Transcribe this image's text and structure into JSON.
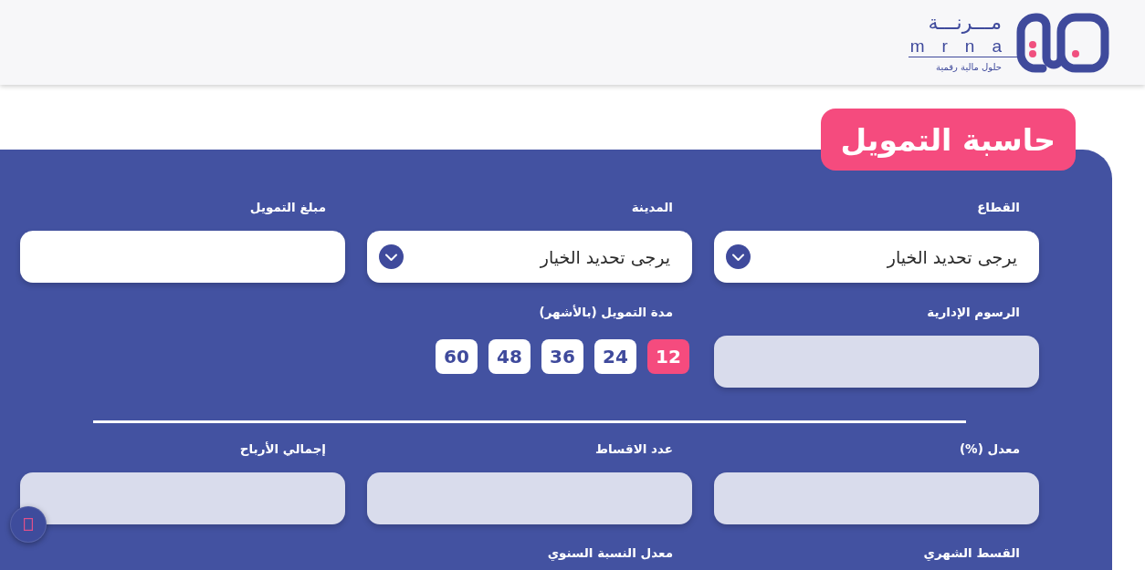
{
  "header": {
    "logo": {
      "name": "مـــرنـــة",
      "latin_name": "mrna",
      "tagline": "حلول مالية رقمية"
    }
  },
  "calculator": {
    "title": "حاسبة التمويل",
    "sections": [
      {
        "fields": [
          {
            "kind": "select",
            "label": "القطاع",
            "placeholder": "يرجى تحديد الخيار"
          },
          {
            "kind": "select",
            "label": "المدينة",
            "placeholder": "يرجى تحديد الخيار"
          },
          {
            "kind": "input",
            "label": "مبلغ التمويل"
          },
          {
            "kind": "output",
            "label": "الرسوم الإدارية"
          },
          {
            "kind": "choices",
            "label": "مدة التمويل (بالأشهر)",
            "options": [
              {
                "label": "12",
                "selected": true
              },
              {
                "label": "24",
                "selected": false
              },
              {
                "label": "36",
                "selected": false
              },
              {
                "label": "48",
                "selected": false
              },
              {
                "label": "60",
                "selected": false
              }
            ]
          }
        ]
      },
      {
        "fields": [
          {
            "kind": "output",
            "label": "معدل (%)"
          },
          {
            "kind": "output",
            "label": "عدد الاقساط"
          },
          {
            "kind": "output",
            "label": "إجمالي الأرباح"
          },
          {
            "kind": "label",
            "label": "القسط الشهري"
          },
          {
            "kind": "label",
            "label": "معدل النسبة السنوي"
          }
        ]
      }
    ]
  }
}
